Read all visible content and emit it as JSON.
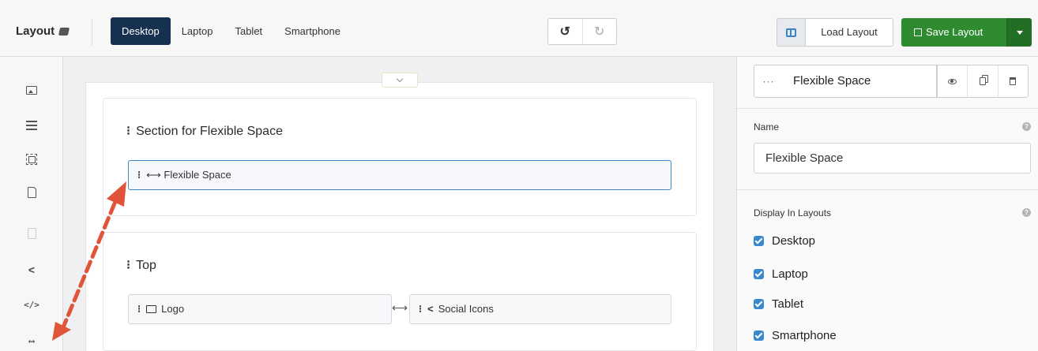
{
  "header": {
    "title": "Layout",
    "device_tabs": [
      {
        "label": "Desktop",
        "active": true
      },
      {
        "label": "Laptop",
        "active": false
      },
      {
        "label": "Tablet",
        "active": false
      },
      {
        "label": "Smartphone",
        "active": false
      }
    ],
    "undo_icon": "undo-icon",
    "redo_icon": "redo-icon",
    "load_label": "Load Layout",
    "save_label": "Save Layout"
  },
  "sidebar": {
    "icons": [
      "image-icon",
      "menu-icon",
      "frame-icon",
      "file-icon",
      "file-disabled-icon",
      "share-icon",
      "code-icon",
      "flexible-space-icon"
    ],
    "code_glyph": "</>",
    "flex_glyph": "⟷"
  },
  "canvas": {
    "sections": [
      {
        "title": "Section for Flexible Space",
        "modules": [
          {
            "label": "Flexible Space",
            "icon": "⟷",
            "selected": true
          }
        ]
      },
      {
        "title": "Top",
        "modules": [
          {
            "label": "Logo",
            "icon": "image-icon",
            "selected": false
          },
          {
            "label": "Social Icons",
            "icon": "share-icon",
            "selected": false
          }
        ],
        "separator": "⟷"
      }
    ]
  },
  "panel": {
    "more_label": "···",
    "title": "Flexible Space",
    "name_label": "Name",
    "name_value": "Flexible Space",
    "display_label": "Display In Layouts",
    "layouts": [
      {
        "label": "Desktop",
        "checked": true
      },
      {
        "label": "Laptop",
        "checked": true
      },
      {
        "label": "Tablet",
        "checked": true
      },
      {
        "label": "Smartphone",
        "checked": true
      }
    ]
  },
  "colors": {
    "active_tab": "#16314f",
    "save_button": "#2e8b30",
    "selection": "#3d87c8",
    "annotation_arrow": "#e0553a"
  }
}
